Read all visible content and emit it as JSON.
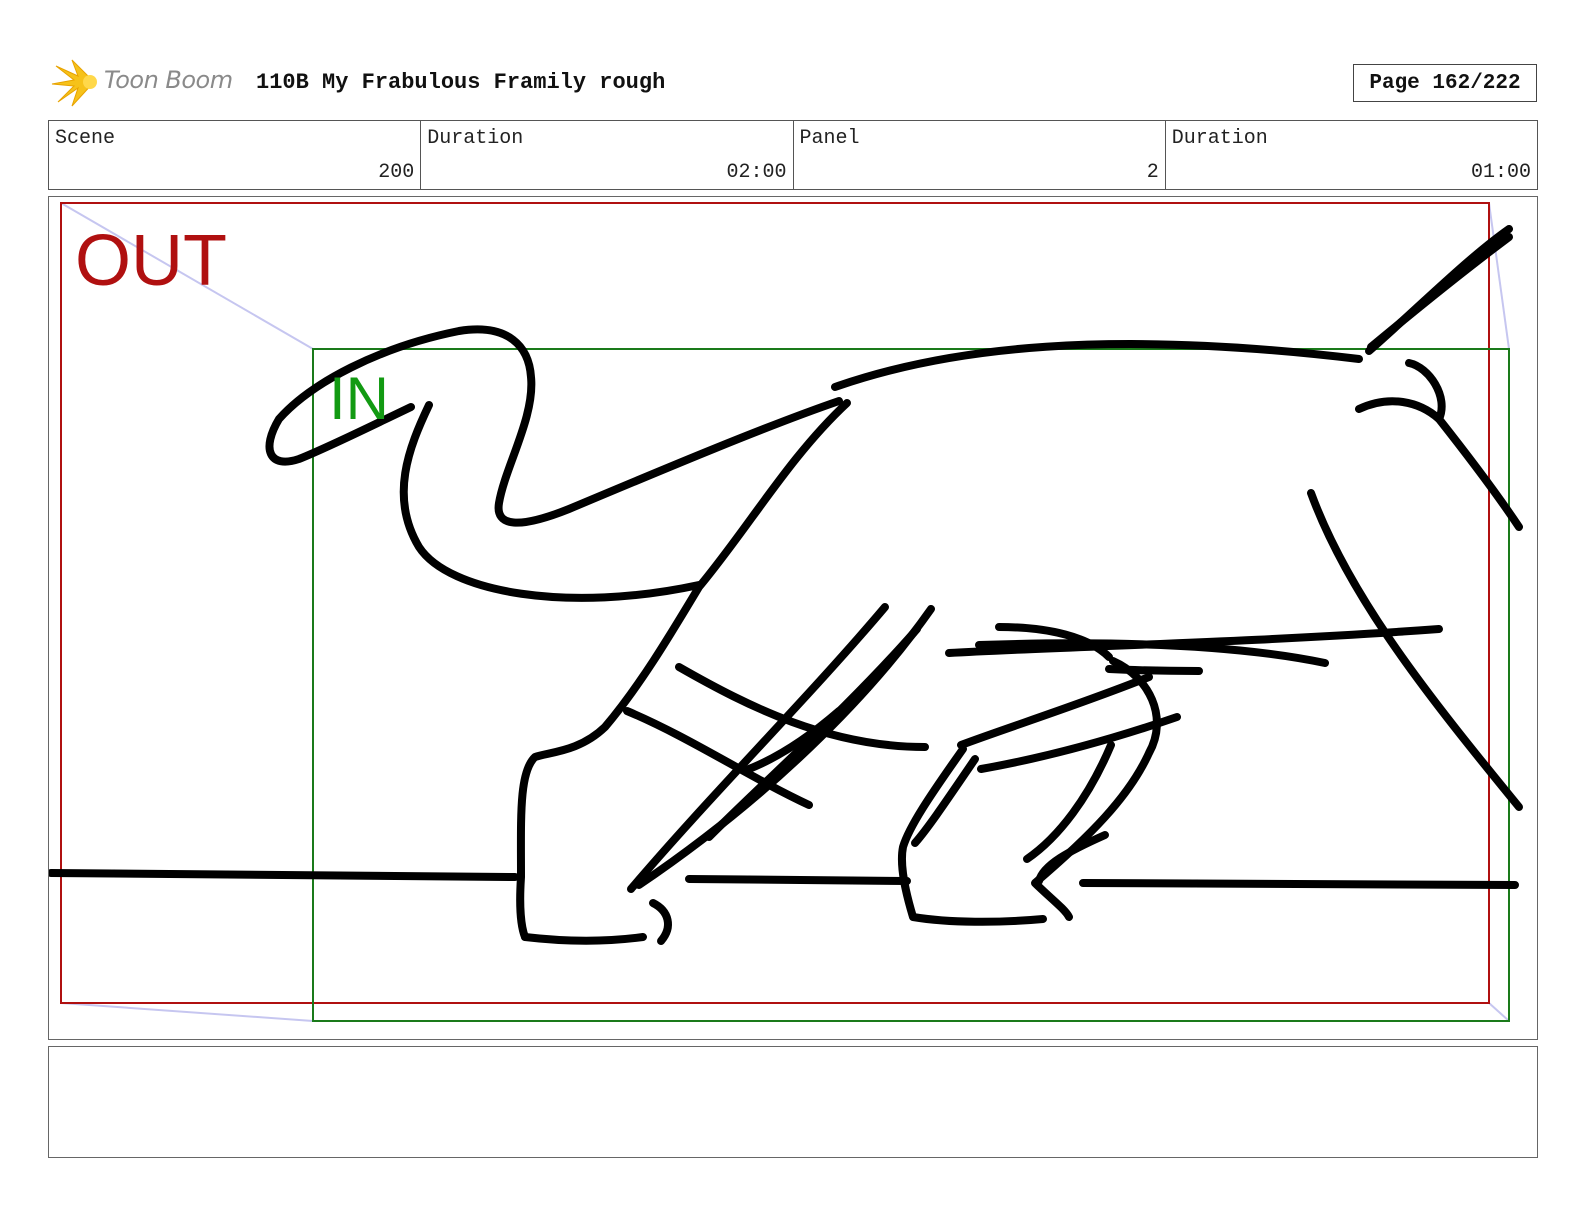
{
  "header": {
    "logo_text": "Toon Boom",
    "project_title": "110B My Frabulous Framily rough",
    "page_label": "Page 162/222"
  },
  "info": {
    "scene_label": "Scene",
    "scene_value": "200",
    "scene_duration_label": "Duration",
    "scene_duration_value": "02:00",
    "panel_label": "Panel",
    "panel_value": "2",
    "panel_duration_label": "Duration",
    "panel_duration_value": "01:00"
  },
  "panel": {
    "out_label": "OUT",
    "in_label": "IN",
    "colors": {
      "out_frame": "#b01010",
      "in_frame": "#1a7a1a",
      "camera_path": "#c6c6f0",
      "sketch": "#000000"
    }
  },
  "notes": {
    "text": ""
  }
}
